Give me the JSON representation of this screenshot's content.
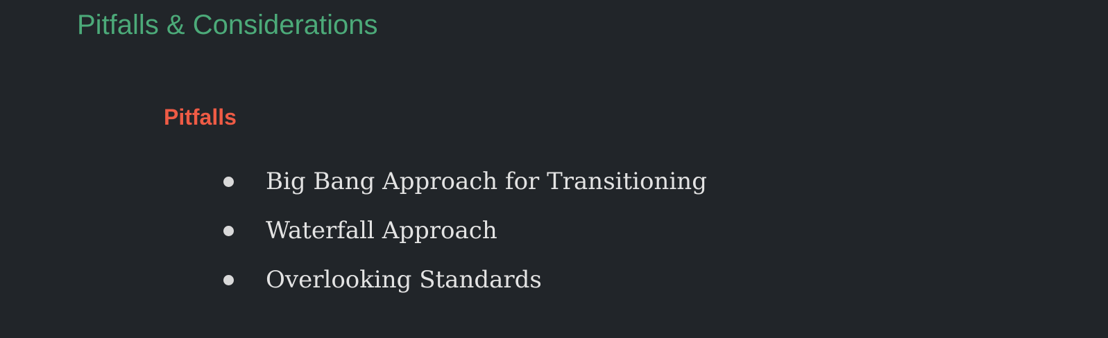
{
  "slide": {
    "title": "Pitfalls & Considerations",
    "section_heading": "Pitfalls",
    "bullets": [
      {
        "text": "Big Bang Approach for Transitioning"
      },
      {
        "text": "Waterfall Approach"
      },
      {
        "text": "Overlooking Standards"
      }
    ]
  },
  "colors": {
    "background": "#212529",
    "title": "#4caa79",
    "section_heading": "#ee5b45",
    "bullet_text": "#e3e3e3",
    "bullet_dot": "#d9d9d9"
  }
}
